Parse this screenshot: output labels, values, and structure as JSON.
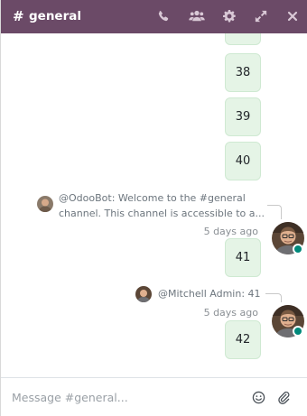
{
  "header": {
    "hash": "#",
    "title": "general",
    "icons": [
      "phone-icon",
      "members-icon",
      "gear-icon",
      "expand-icon",
      "close-icon"
    ],
    "background": "#6b4a67"
  },
  "messages": [
    {
      "text": "38"
    },
    {
      "text": "39"
    },
    {
      "text": "40"
    },
    {
      "parent": {
        "author": "@OdooBot:",
        "body_line1": "Welcome to the #general",
        "body_line2": "channel. This channel is accessible to a..."
      },
      "timestamp": "5 days ago",
      "text": "41"
    },
    {
      "parent": {
        "author": "@Mitchell Admin:",
        "body_line1": "41"
      },
      "timestamp": "5 days ago",
      "text": "42"
    }
  ],
  "composer": {
    "placeholder": "Message #general...",
    "icons": [
      "emoji-icon",
      "attachment-icon"
    ]
  },
  "colors": {
    "bubble": "#e5f4e6",
    "status_online": "#00897b"
  }
}
